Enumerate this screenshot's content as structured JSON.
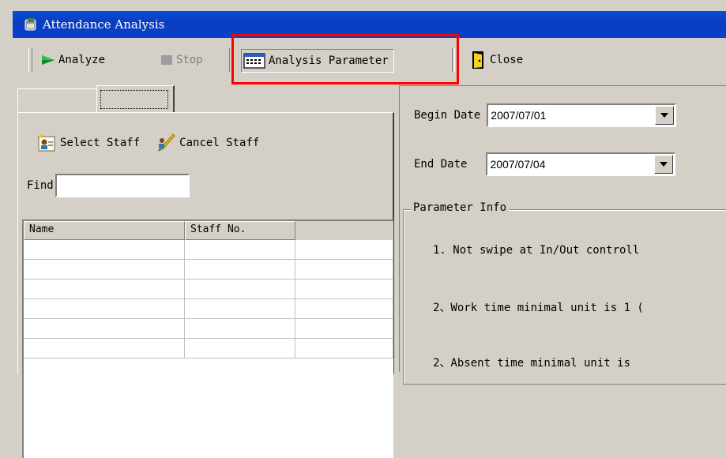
{
  "window": {
    "title": "Attendance Analysis"
  },
  "toolbar": {
    "analyze_label": "Analyze",
    "stop_label": "Stop",
    "analysis_parameter_label": "Analysis Parameter",
    "close_label": "Close",
    "highlight_color": "#ff0000"
  },
  "left": {
    "select_staff_label": "Select Staff",
    "cancel_staff_label": "Cancel Staff",
    "find_label": "Find",
    "find_value": "",
    "columns": [
      "Name",
      "Staff No.",
      ""
    ],
    "rows": [
      [
        "",
        "",
        ""
      ],
      [
        "",
        "",
        ""
      ],
      [
        "",
        "",
        ""
      ],
      [
        "",
        "",
        ""
      ],
      [
        "",
        "",
        ""
      ],
      [
        "",
        "",
        ""
      ]
    ]
  },
  "right": {
    "begin_date_label": "Begin Date",
    "begin_date_value": "2007/07/01",
    "end_date_label": "End Date",
    "end_date_value": "2007/07/04",
    "parameter_info_label": "Parameter Info",
    "info_lines": [
      "1. Not swipe at In/Out controll",
      "2、Work time minimal unit is 1 (",
      "2、Absent time minimal unit is"
    ]
  },
  "icons": {
    "app": "app-icon",
    "analyze": "play-arrow-icon",
    "stop": "stop-square-icon",
    "parameter": "calendar-grid-icon",
    "close": "exit-door-icon",
    "select_staff": "select-staff-icon",
    "cancel_staff": "cancel-staff-icon"
  }
}
